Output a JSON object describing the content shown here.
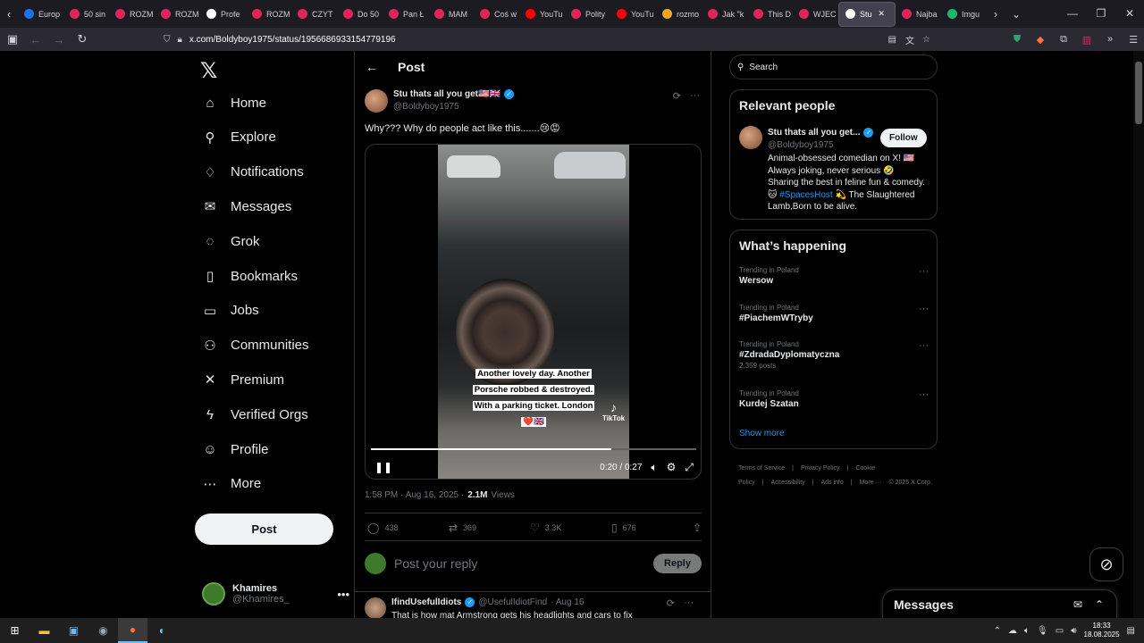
{
  "browser": {
    "tabs": [
      {
        "title": "Europ",
        "color": "#1a73e8"
      },
      {
        "title": "50 sin",
        "color": "#e0245e"
      },
      {
        "title": "ROZM",
        "color": "#e0245e"
      },
      {
        "title": "ROZM",
        "color": "#e0245e"
      },
      {
        "title": "Profe",
        "color": "#ffffff"
      },
      {
        "title": "ROZM",
        "color": "#e0245e"
      },
      {
        "title": "CZYT",
        "color": "#e0245e"
      },
      {
        "title": "Do 50",
        "color": "#e0245e"
      },
      {
        "title": "Pan Ł",
        "color": "#e0245e"
      },
      {
        "title": "MAM",
        "color": "#e0245e"
      },
      {
        "title": "Coś w",
        "color": "#e0245e"
      },
      {
        "title": "YouTu",
        "color": "#ff0000"
      },
      {
        "title": "Polity",
        "color": "#e0245e"
      },
      {
        "title": "YouTu",
        "color": "#ff0000"
      },
      {
        "title": "rozmo",
        "color": "#f5a623"
      },
      {
        "title": "Jak \"k",
        "color": "#e0245e"
      },
      {
        "title": "This D",
        "color": "#e0245e"
      },
      {
        "title": "WJEC",
        "color": "#e0245e"
      },
      {
        "title": "Stu",
        "color": "#ffffff",
        "active": true
      },
      {
        "title": "Najba",
        "color": "#e0245e"
      },
      {
        "title": "Imgu",
        "color": "#1bb76e"
      }
    ],
    "url": "x.com/Boldyboy1975/status/1956686933154779196"
  },
  "sidebar": {
    "items": [
      {
        "label": "Home",
        "icon": "home-icon",
        "glyph": "⌂"
      },
      {
        "label": "Explore",
        "icon": "search-icon",
        "glyph": "⚲"
      },
      {
        "label": "Notifications",
        "icon": "bell-icon",
        "glyph": "♢"
      },
      {
        "label": "Messages",
        "icon": "mail-icon",
        "glyph": "✉"
      },
      {
        "label": "Grok",
        "icon": "grok-icon",
        "glyph": "◌"
      },
      {
        "label": "Bookmarks",
        "icon": "bookmark-icon",
        "glyph": "▯"
      },
      {
        "label": "Jobs",
        "icon": "briefcase-icon",
        "glyph": "▭"
      },
      {
        "label": "Communities",
        "icon": "people-icon",
        "glyph": "⚇"
      },
      {
        "label": "Premium",
        "icon": "x-icon",
        "glyph": "✕"
      },
      {
        "label": "Verified Orgs",
        "icon": "lightning-icon",
        "glyph": "ϟ"
      },
      {
        "label": "Profile",
        "icon": "person-icon",
        "glyph": "☺"
      },
      {
        "label": "More",
        "icon": "more-circle-icon",
        "glyph": "⋯"
      }
    ],
    "post_label": "Post",
    "user": {
      "name": "Khamires",
      "handle": "@Khamires_"
    }
  },
  "main": {
    "header_title": "Post",
    "post": {
      "author_name": "Stu thats all you get🇺🇸🇬🇧",
      "author_handle": "@Boldyboy1975",
      "text": "Why??? Why do people act like this.......😢😡",
      "video_caption": "Another lovely day. Another Porsche robbed & destroyed. With a parking ticket. London ❤️🇬🇧",
      "tiktok_label": "TikTok",
      "video_time": "0:20 / 0:27",
      "video_progress": 0.74,
      "timestamp": "1:58 PM · Aug 16, 2025 ·",
      "views": "2.1M",
      "views_label": "Views",
      "stats": {
        "replies": "438",
        "reposts": "369",
        "likes": "3.3K",
        "bookmarks": "676"
      }
    },
    "reply_placeholder": "Post your reply",
    "reply_button": "Reply",
    "next_reply": {
      "name": "IfindUsefulIdiots",
      "handle": "@UsefulIdiotFind",
      "date": "· Aug 16",
      "text": "That is how mat Armstrong gets his headlights and cars to fix"
    }
  },
  "right": {
    "search_placeholder": "Search",
    "relevant_title": "Relevant people",
    "person": {
      "name": "Stu thats all you get...",
      "handle": "@Boldyboy1975",
      "follow": "Follow",
      "bio_pre": "Animal-obsessed comedian on X! 🇺🇸 Always joking, never serious 🤣 Sharing the best in feline fun & comedy.🐱",
      "bio_tag": "#SpacesHost",
      "bio_post": "💫 The Slaughtered Lamb,Born to be alive."
    },
    "happening_title": "What’s happening",
    "trends": [
      {
        "context": "Trending in Poland",
        "name": "Wersow",
        "count": ""
      },
      {
        "context": "Trending in Poland",
        "name": "#PiachemWTryby",
        "count": ""
      },
      {
        "context": "Trending in Poland",
        "name": "#ZdradaDyplomatyczna",
        "count": "2,359 posts"
      },
      {
        "context": "Trending in Poland",
        "name": "Kurdej Szatan",
        "count": ""
      }
    ],
    "show_more": "Show more",
    "footer": [
      "Terms of Service",
      "|",
      "Privacy Policy",
      "|",
      "Cookie Policy",
      "|",
      "Accessibility",
      "|",
      "Ads info",
      "|",
      "More ···",
      "© 2025 X Corp."
    ]
  },
  "messages_dock": {
    "title": "Messages"
  },
  "taskbar": {
    "time": "18:33",
    "date": "18.08.2025"
  }
}
